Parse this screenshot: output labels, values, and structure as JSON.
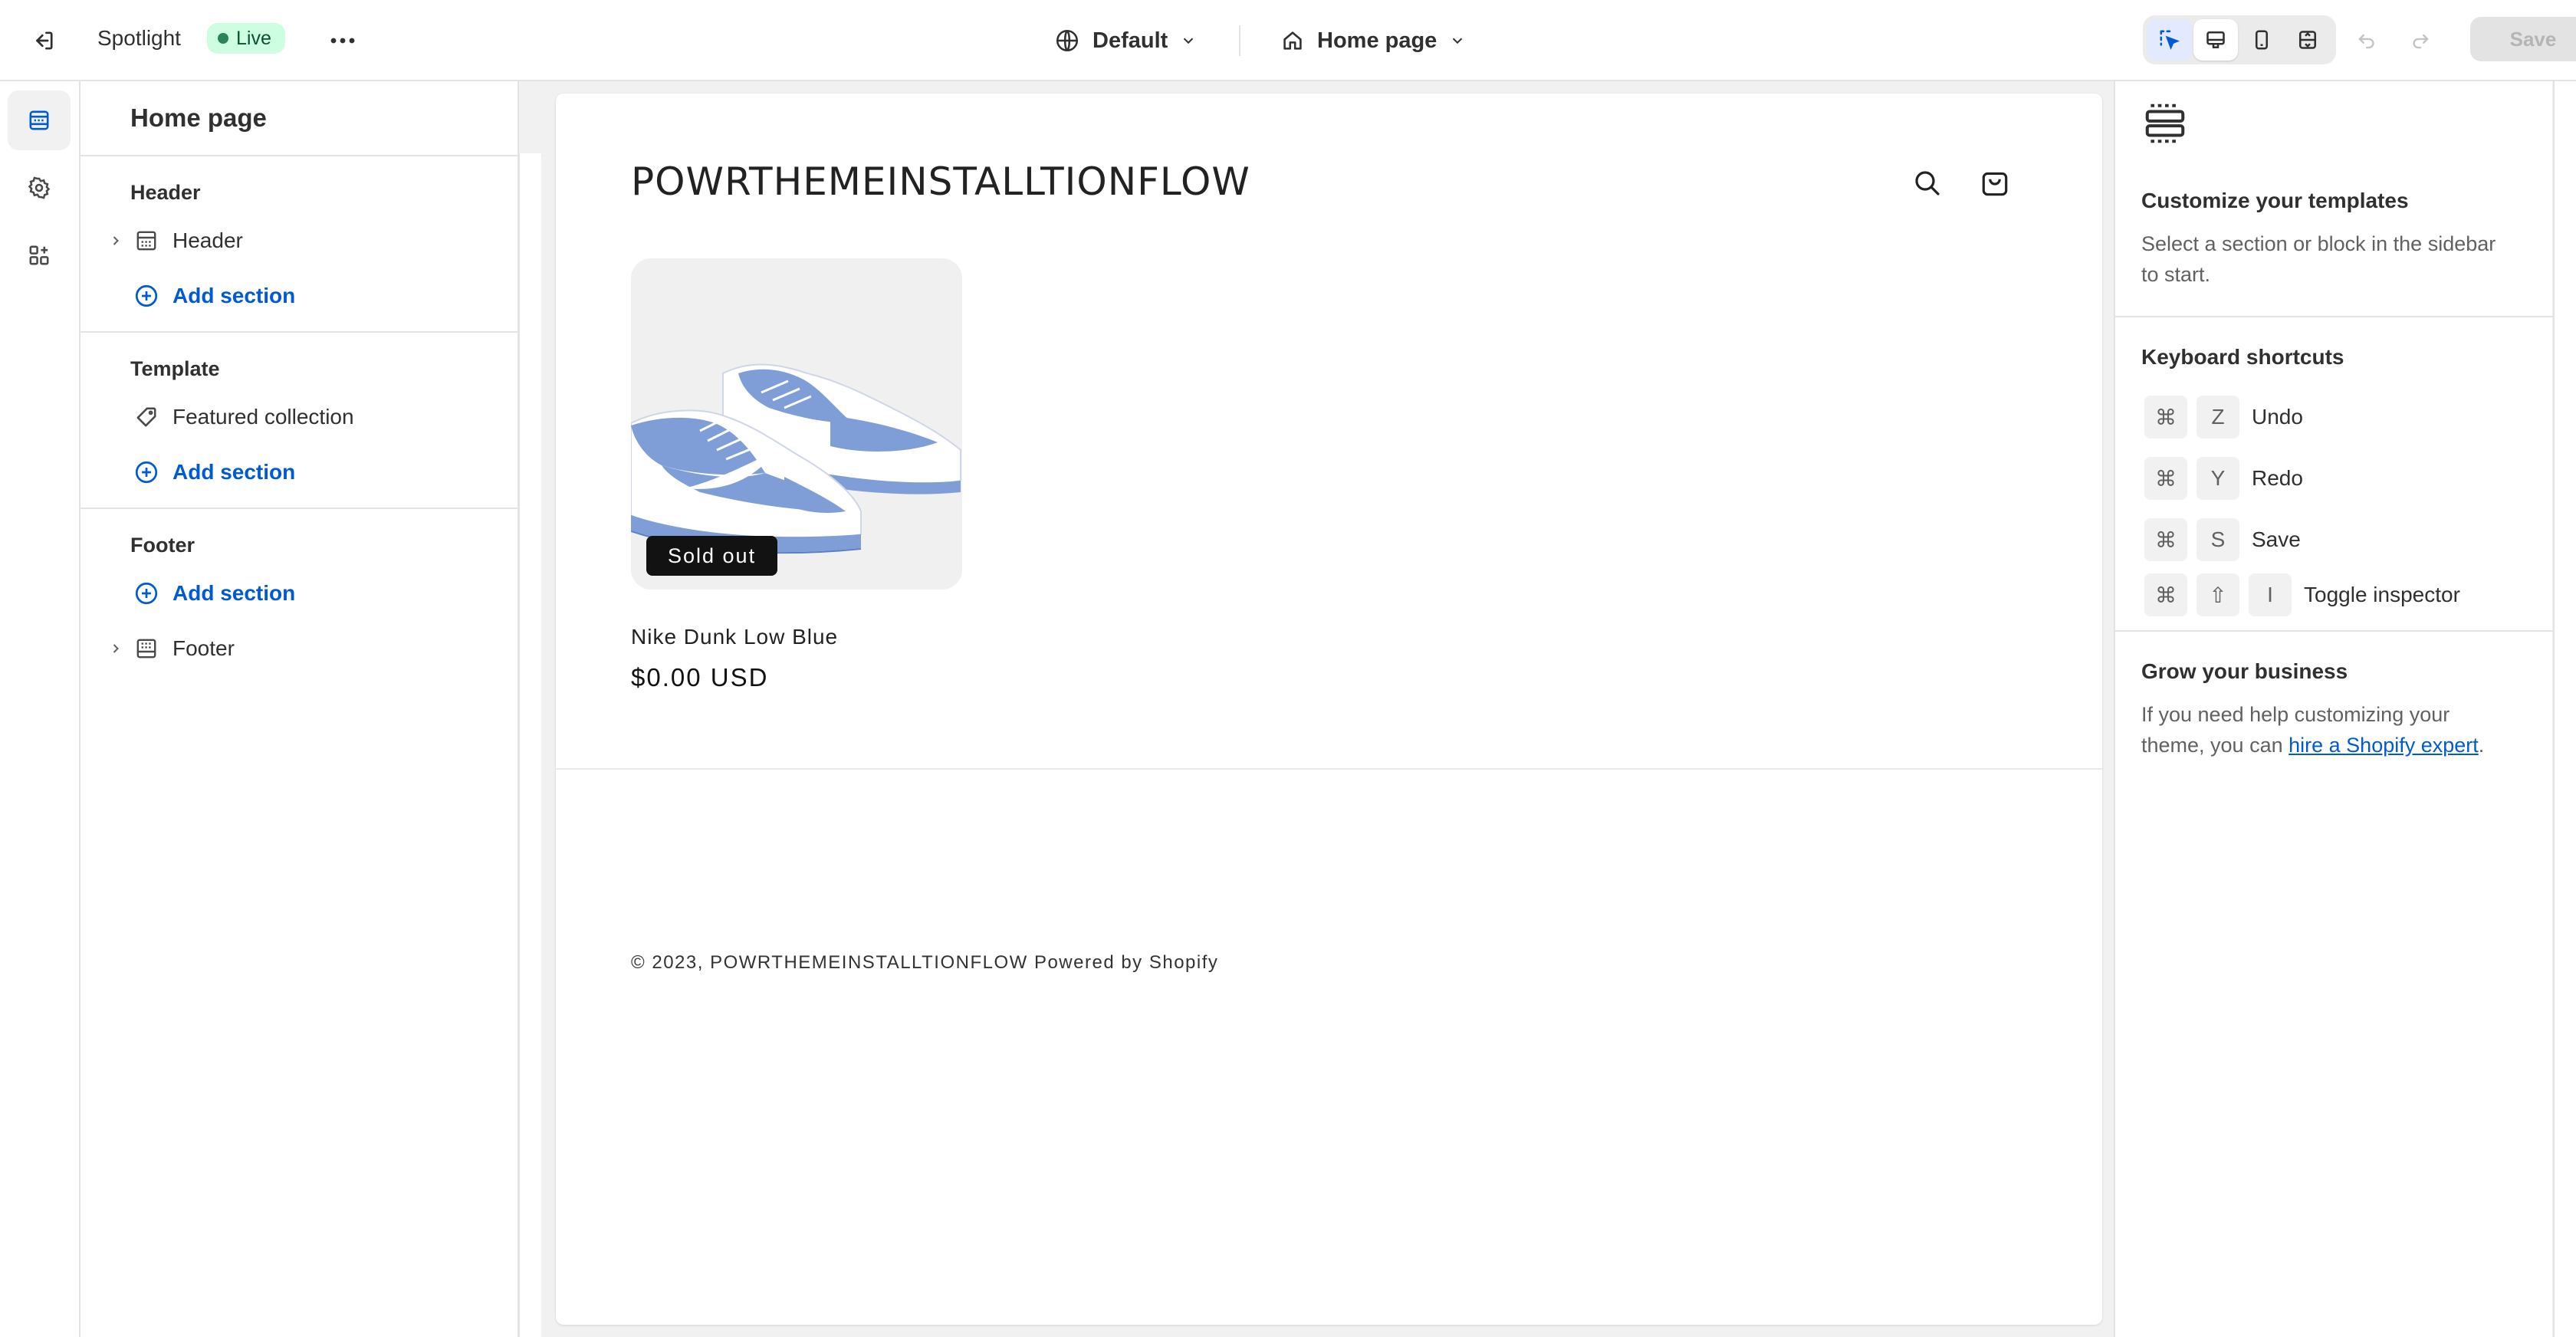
{
  "topbar": {
    "app_title": "Spotlight",
    "status_badge": "Live",
    "theme_select": "Default",
    "page_select": "Home page",
    "save_label": "Save"
  },
  "sidebar": {
    "title": "Home page",
    "groups": [
      {
        "title": "Header",
        "items": [
          {
            "label": "Header",
            "icon": "header-layout-icon",
            "expandable": true
          },
          {
            "label": "Add section",
            "icon": "plus-circle-icon",
            "action": true
          }
        ]
      },
      {
        "title": "Template",
        "items": [
          {
            "label": "Featured collection",
            "icon": "tag-icon",
            "expandable": false
          },
          {
            "label": "Add section",
            "icon": "plus-circle-icon",
            "action": true
          }
        ]
      },
      {
        "title": "Footer",
        "items": [
          {
            "label": "Add section",
            "icon": "plus-circle-icon",
            "action": true
          },
          {
            "label": "Footer",
            "icon": "footer-layout-icon",
            "expandable": true
          }
        ]
      }
    ]
  },
  "preview": {
    "store_name": "POWRTHEMEINSTALLTIONFLOW",
    "product": {
      "badge": "Sold out",
      "title": "Nike Dunk Low Blue",
      "price": "$0.00 USD"
    },
    "footer_text": "© 2023, POWRTHEMEINSTALLTIONFLOW Powered by Shopify"
  },
  "inspector": {
    "customize_title": "Customize your templates",
    "customize_body": "Select a section or block in the sidebar to start.",
    "shortcuts_title": "Keyboard shortcuts",
    "shortcuts": [
      {
        "keys": [
          "⌘",
          "Z"
        ],
        "label": "Undo"
      },
      {
        "keys": [
          "⌘",
          "Y"
        ],
        "label": "Redo"
      },
      {
        "keys": [
          "⌘",
          "S"
        ],
        "label": "Save"
      },
      {
        "keys": [
          "⌘",
          "⇧",
          "I"
        ],
        "label": "Toggle inspector"
      }
    ],
    "grow_title": "Grow your business",
    "grow_body_pre": "If you need help customizing your theme, you can ",
    "grow_link": "hire a Shopify expert",
    "grow_body_post": "."
  },
  "colors": {
    "accent": "#005bd3",
    "live_badge_bg": "#cdfee1",
    "live_dot": "#29845a",
    "shoe_blue": "#7f9ed8"
  }
}
